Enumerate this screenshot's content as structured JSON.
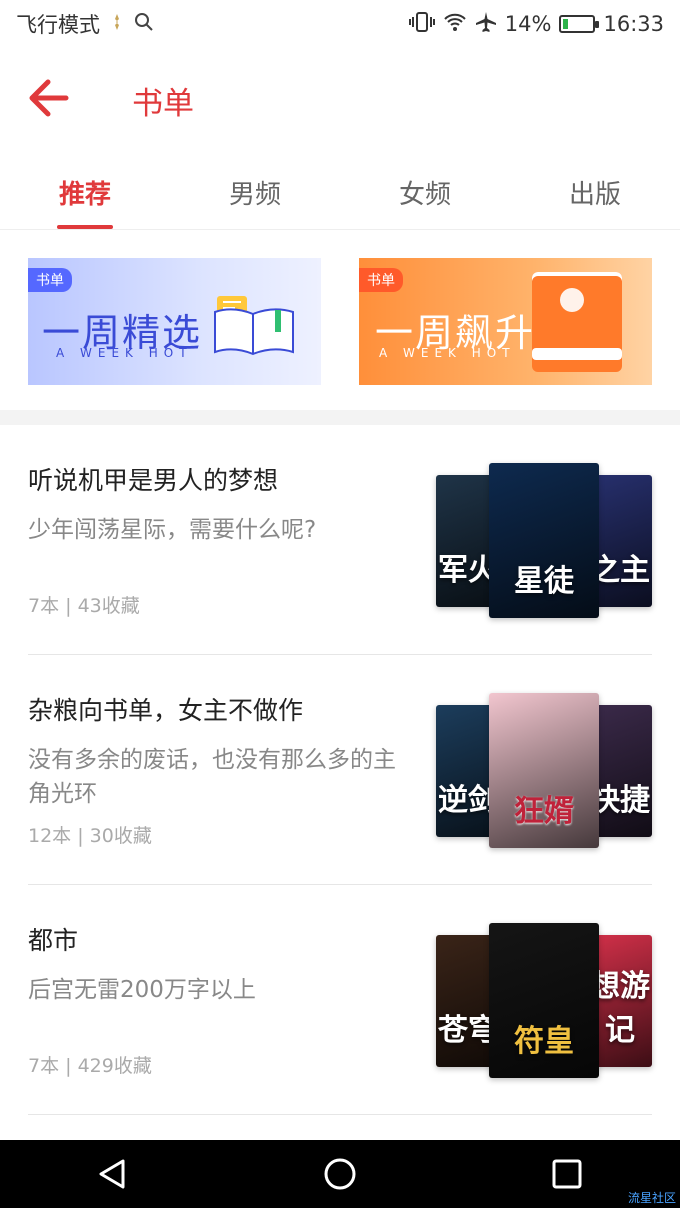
{
  "status_bar": {
    "mode": "飞行模式",
    "battery": "14%",
    "battery_level": 0.14,
    "time": "16:33"
  },
  "header": {
    "title": "书单"
  },
  "tabs": [
    {
      "label": "推荐",
      "active": true
    },
    {
      "label": "男频",
      "active": false
    },
    {
      "label": "女频",
      "active": false
    },
    {
      "label": "出版",
      "active": false
    }
  ],
  "banners": [
    {
      "tag": "书单",
      "title": "一周精选",
      "subtitle": "A WEEK HOT"
    },
    {
      "tag": "书单",
      "title": "一周飙升",
      "subtitle": "A WEEK HOT"
    }
  ],
  "booklists": [
    {
      "title": "听说机甲是男人的梦想",
      "desc": "少年闯荡星际，需要什么呢?",
      "meta": "7本 | 43收藏",
      "covers": [
        {
          "text": "军火",
          "color": "#1f3448"
        },
        {
          "text": "星徒",
          "color": "#0e2a4f"
        },
        {
          "text": "之主",
          "color": "#27306e"
        }
      ]
    },
    {
      "title": "杂粮向书单，女主不做作",
      "desc": "没有多余的废话，也没有那么多的主角光环",
      "meta": "12本 | 30收藏",
      "covers": [
        {
          "text": "逆剑",
          "color": "#1c3d5c"
        },
        {
          "text": "狂婿",
          "color": "#f2c6cf"
        },
        {
          "text": "快捷",
          "color": "#3b2a4a"
        }
      ]
    },
    {
      "title": "都市",
      "desc": "后宫无雷200万字以上",
      "meta": "7本 | 429收藏",
      "covers": [
        {
          "text": "苍穹",
          "color": "#3a2418"
        },
        {
          "text": "符皇",
          "color": "#151515"
        },
        {
          "text": "想游记",
          "color": "#d23049"
        }
      ]
    }
  ],
  "watermark": "流星社区",
  "colors": {
    "accent": "#e0393b",
    "nav_bg": "#000000"
  }
}
